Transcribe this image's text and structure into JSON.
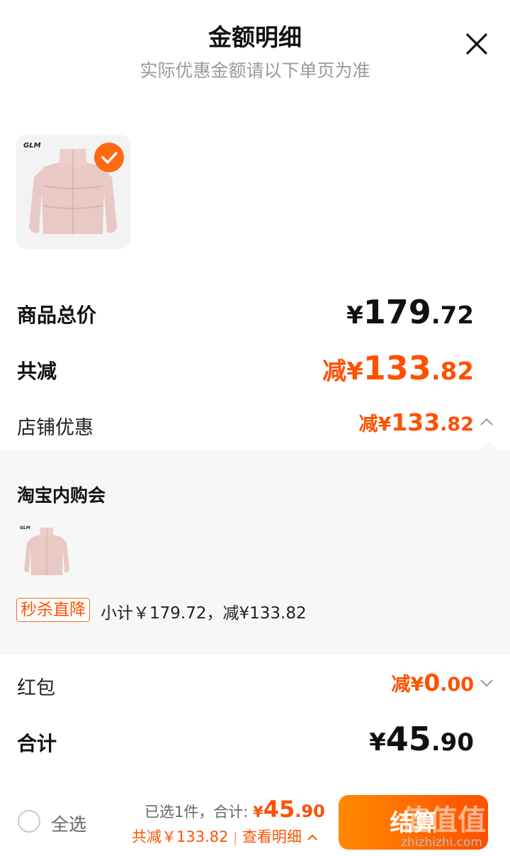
{
  "header": {
    "title": "金额明细",
    "subtitle": "实际优惠金额请以下单页为准"
  },
  "product": {
    "brand": "GLM",
    "selected": true
  },
  "rows": {
    "total_price": {
      "label": "商品总价",
      "yen": "¥",
      "int": "179",
      "dec": ".72"
    },
    "total_discount": {
      "label": "共减",
      "prefix": "减",
      "yen": "¥",
      "int": "133",
      "dec": ".82"
    },
    "store_discount": {
      "label": "店铺优惠",
      "prefix": "减",
      "yen": "¥",
      "int": "133",
      "dec": ".82"
    },
    "red_packet": {
      "label": "红包",
      "prefix": "减",
      "yen": "¥",
      "int": "0",
      "dec": ".00"
    },
    "grand_total": {
      "label": "合计",
      "yen": "¥",
      "int": "45",
      "dec": ".90"
    }
  },
  "store_panel": {
    "store_name": "淘宝内购会",
    "brand": "GLM",
    "tag": "秒杀直降",
    "subtotal_text": "小计￥179.72，减¥133.82"
  },
  "bottom_bar": {
    "select_all": "全选",
    "selected_text": "已选1件，合计:",
    "total_yen": "¥",
    "total_int": "45",
    "total_dec": ".90",
    "discount_text": "共减￥133.82",
    "separator": "|",
    "detail_link": "查看明细",
    "settle_button": "结算"
  },
  "watermark": {
    "logo": "值值值",
    "url": "zhizhizhi.com"
  },
  "colors": {
    "accent": "#ff5000",
    "muted": "#999999",
    "panel_bg": "#f7f7f7"
  }
}
